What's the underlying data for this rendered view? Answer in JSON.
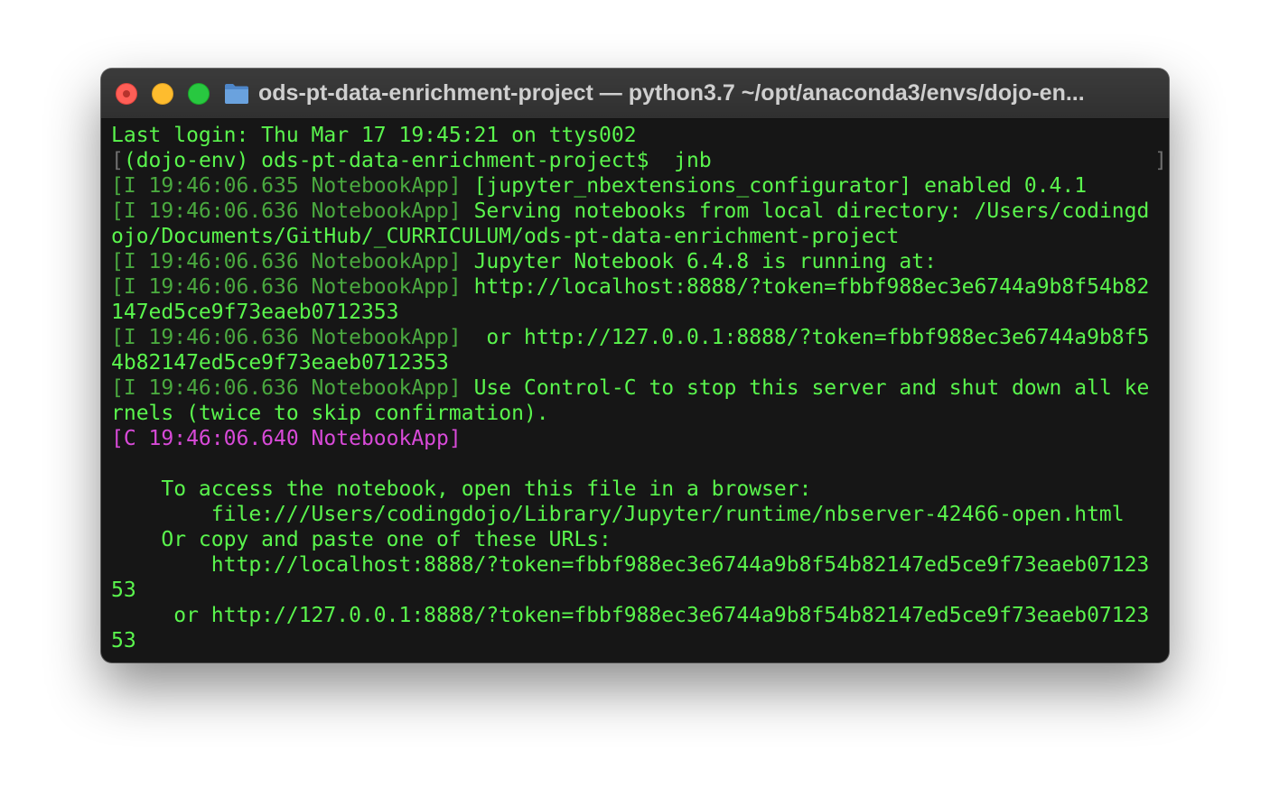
{
  "window": {
    "title": "ods-pt-data-enrichment-project — python3.7 ~/opt/anaconda3/envs/dojo-en..."
  },
  "icons": {
    "close": "close-button",
    "minimize": "minimize-button",
    "zoom": "zoom-button",
    "folder": "folder-icon"
  },
  "colors": {
    "text": "#5af54d",
    "log_prefix": "#4aa93f",
    "critical_prefix": "#d84ad8",
    "background": "#161616"
  },
  "terminal": {
    "last_login": "Last login: Thu Mar 17 19:45:21 on ttys002",
    "prompt": "(dojo-env) ods-pt-data-enrichment-project$  jnb",
    "log1_prefix": "[I 19:46:06.635 NotebookApp]",
    "log1_msg": " [jupyter_nbextensions_configurator] enabled 0.4.1",
    "log2_prefix": "[I 19:46:06.636 NotebookApp]",
    "log2_msg": " Serving notebooks from local directory: /Users/codingd",
    "log2_cont": "ojo/Documents/GitHub/_CURRICULUM/ods-pt-data-enrichment-project",
    "log3_prefix": "[I 19:46:06.636 NotebookApp]",
    "log3_msg": " Jupyter Notebook 6.4.8 is running at:",
    "log4_prefix": "[I 19:46:06.636 NotebookApp]",
    "log4_msg": " http://localhost:8888/?token=fbbf988ec3e6744a9b8f54b82",
    "log4_cont": "147ed5ce9f73eaeb0712353",
    "log5_prefix": "[I 19:46:06.636 NotebookApp]",
    "log5_msg": "  or http://127.0.0.1:8888/?token=fbbf988ec3e6744a9b8f5",
    "log5_cont": "4b82147ed5ce9f73eaeb0712353",
    "log6_prefix": "[I 19:46:06.636 NotebookApp]",
    "log6_msg": " Use Control-C to stop this server and shut down all ke",
    "log6_cont": "rnels (twice to skip confirmation).",
    "log7_prefix": "[C 19:46:06.640 NotebookApp]",
    "blank": "",
    "access_line": "    To access the notebook, open this file in a browser:",
    "file_line": "        file:///Users/codingdojo/Library/Jupyter/runtime/nbserver-42466-open.html",
    "copy_line": "    Or copy and paste one of these URLs:",
    "url1_line": "        http://localhost:8888/?token=fbbf988ec3e6744a9b8f54b82147ed5ce9f73eaeb07123",
    "url1_cont": "53",
    "url2_line": "     or http://127.0.0.1:8888/?token=fbbf988ec3e6744a9b8f54b82147ed5ce9f73eaeb07123",
    "url2_cont": "53"
  }
}
